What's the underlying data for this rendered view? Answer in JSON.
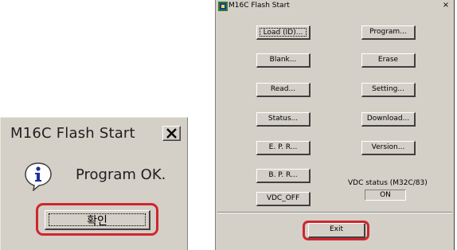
{
  "dialog": {
    "title": "M16C Flash Start",
    "close_glyph": "✕",
    "icon": "info-icon",
    "message": "Program OK.",
    "ok_label": "확인"
  },
  "window": {
    "title": "M16C Flash Start",
    "close_glyph": "×",
    "buttons_left": [
      "Load (ID)...",
      "Blank...",
      "Read...",
      "Status...",
      "E. P. R...",
      "B. P. R...",
      "VDC_OFF"
    ],
    "buttons_right": [
      "Program...",
      "Erase",
      "Setting...",
      "Download...",
      "Version..."
    ],
    "vdc_status_label": "VDC status (M32C/83)",
    "vdc_status_value": "ON",
    "exit_label": "Exit"
  },
  "colors": {
    "face": "#d4d0c8",
    "highlight": "#d0252d",
    "info_blue": "#1e2fa0"
  }
}
